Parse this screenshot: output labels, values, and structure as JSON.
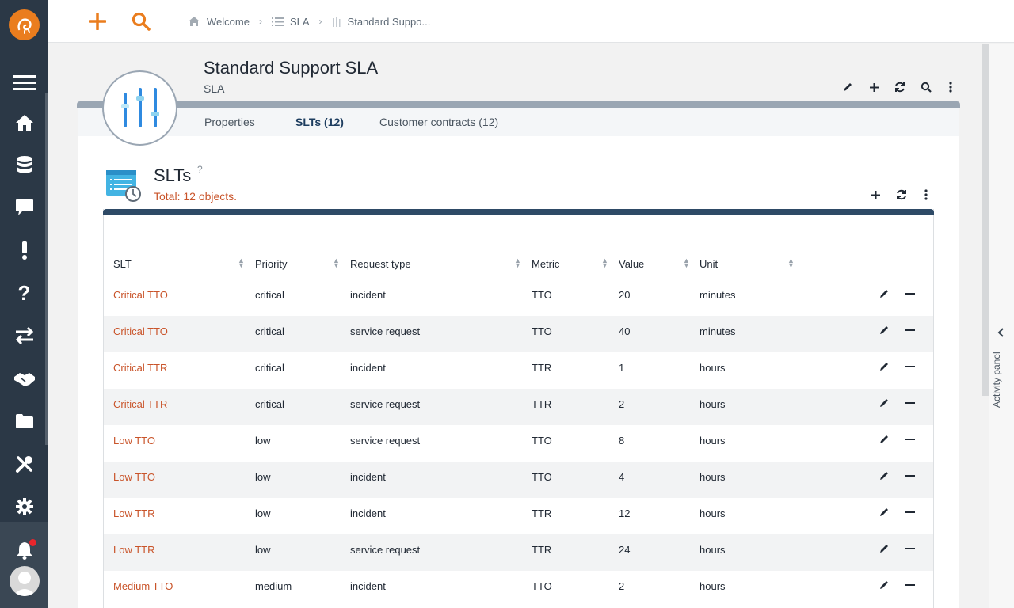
{
  "breadcrumb": [
    {
      "icon": "home-icon",
      "label": "Welcome"
    },
    {
      "icon": "list-icon",
      "label": "SLA"
    },
    {
      "icon": "sliders-icon",
      "label": "Standard Suppo..."
    }
  ],
  "object": {
    "title": "Standard Support SLA",
    "class": "SLA",
    "tabs": [
      {
        "label": "Properties",
        "active": false
      },
      {
        "label": "SLTs (12)",
        "active": true
      },
      {
        "label": "Customer contracts (12)",
        "active": false
      }
    ]
  },
  "slts": {
    "title": "SLTs",
    "help": "?",
    "count": "Total: 12  objects.",
    "columns": [
      "SLT",
      "Priority",
      "Request type",
      "Metric",
      "Value",
      "Unit"
    ],
    "rows": [
      {
        "slt": "Critical TTO",
        "priority": "critical",
        "request_type": "incident",
        "metric": "TTO",
        "value": "20",
        "unit": "minutes"
      },
      {
        "slt": "Critical TTO",
        "priority": "critical",
        "request_type": "service request",
        "metric": "TTO",
        "value": "40",
        "unit": "minutes"
      },
      {
        "slt": "Critical TTR",
        "priority": "critical",
        "request_type": "incident",
        "metric": "TTR",
        "value": "1",
        "unit": "hours"
      },
      {
        "slt": "Critical TTR",
        "priority": "critical",
        "request_type": "service request",
        "metric": "TTR",
        "value": "2",
        "unit": "hours"
      },
      {
        "slt": "Low TTO",
        "priority": "low",
        "request_type": "service request",
        "metric": "TTO",
        "value": "8",
        "unit": "hours"
      },
      {
        "slt": "Low TTO",
        "priority": "low",
        "request_type": "incident",
        "metric": "TTO",
        "value": "4",
        "unit": "hours"
      },
      {
        "slt": "Low TTR",
        "priority": "low",
        "request_type": "incident",
        "metric": "TTR",
        "value": "12",
        "unit": "hours"
      },
      {
        "slt": "Low TTR",
        "priority": "low",
        "request_type": "service request",
        "metric": "TTR",
        "value": "24",
        "unit": "hours"
      },
      {
        "slt": "Medium TTO",
        "priority": "medium",
        "request_type": "incident",
        "metric": "TTO",
        "value": "2",
        "unit": "hours"
      }
    ]
  },
  "activity_panel": {
    "label": "Activity panel"
  },
  "colors": {
    "accent": "#ea7d1e",
    "link": "#c9542a",
    "sidebar": "#2b3846",
    "table_header": "#2e4a66"
  }
}
